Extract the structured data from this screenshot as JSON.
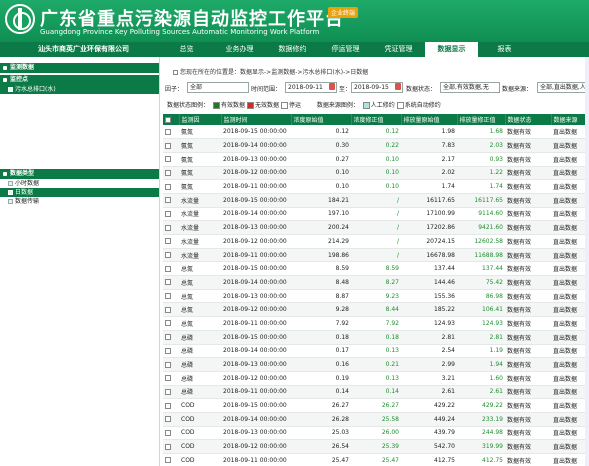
{
  "header": {
    "title": "广东省重点污染源自动监控工作平台",
    "subtitle": "Guangdong Province Key Polluting Sources Automatic Monitoring Work Platform",
    "badge": "企业终端"
  },
  "nav": {
    "company": "汕头市商英广业环保有限公司",
    "items": [
      "总览",
      "业务办理",
      "数据修约",
      "停运管理",
      "凭证管理",
      "数据显示",
      "报表"
    ],
    "active_index": 5
  },
  "sidebar": {
    "monitor_header": "监测数据",
    "point_header": "监控点",
    "point_item": "污水总排口(水)",
    "type_header": "数据类型",
    "types": [
      "小时数据",
      "日数据",
      "数据传输"
    ],
    "selected_type_index": 1
  },
  "breadcrumb": "您现在所在的位置是：数据显示->监测数据->污水总排口(水)->日数据",
  "filters": {
    "factor_label": "因子：",
    "factor_value": "全部",
    "time_label": "时间范围：",
    "start_date": "2018-09-11",
    "to_label": "至：",
    "end_date": "2018-09-15",
    "status_label": "数据状态：",
    "status_value": "全部,有效数据,无",
    "source_label": "数据来源：",
    "source_value": "全部,直出数据,人"
  },
  "legend": {
    "status_label": "数据状态图例：",
    "status_items": [
      {
        "label": "有效数据",
        "color": "#1f7a1f"
      },
      {
        "label": "无效数据",
        "color": "#d62a1e"
      },
      {
        "label": "停运",
        "color": "#ffffff"
      }
    ],
    "source_label": "数据来源图例：",
    "source_items": [
      {
        "label": "人工修约",
        "color": "#a8e6e0"
      },
      {
        "label": "系统自动修约",
        "color": "#ffffff"
      }
    ]
  },
  "table": {
    "columns": [
      "监测因",
      "监测时间",
      "浓度原始值",
      "浓度修正值",
      "排放量原始值",
      "排放量修正值",
      "数据状态",
      "数据来源"
    ],
    "rows": [
      [
        "氨氮",
        "2018-09-15 00:00:00",
        "0.12",
        "0.12",
        "1.98",
        "1.68",
        "数据有效",
        "直出数据"
      ],
      [
        "氨氮",
        "2018-09-14 00:00:00",
        "0.30",
        "0.22",
        "7.83",
        "2.03",
        "数据有效",
        "直出数据"
      ],
      [
        "氨氮",
        "2018-09-13 00:00:00",
        "0.27",
        "0.10",
        "2.17",
        "0.93",
        "数据有效",
        "直出数据"
      ],
      [
        "氨氮",
        "2018-09-12 00:00:00",
        "0.10",
        "0.10",
        "2.02",
        "1.22",
        "数据有效",
        "直出数据"
      ],
      [
        "氨氮",
        "2018-09-11 00:00:00",
        "0.10",
        "0.10",
        "1.74",
        "1.74",
        "数据有效",
        "直出数据"
      ],
      [
        "水流量",
        "2018-09-15 00:00:00",
        "184.21",
        "/",
        "16117.65",
        "16117.65",
        "数据有效",
        "直出数据"
      ],
      [
        "水流量",
        "2018-09-14 00:00:00",
        "197.10",
        "/",
        "17100.99",
        "9114.60",
        "数据有效",
        "直出数据"
      ],
      [
        "水流量",
        "2018-09-13 00:00:00",
        "200.24",
        "/",
        "17202.86",
        "9421.60",
        "数据有效",
        "直出数据"
      ],
      [
        "水流量",
        "2018-09-12 00:00:00",
        "214.29",
        "/",
        "20724.15",
        "12602.58",
        "数据有效",
        "直出数据"
      ],
      [
        "水流量",
        "2018-09-11 00:00:00",
        "198.86",
        "/",
        "16678.98",
        "11688.98",
        "数据有效",
        "直出数据"
      ],
      [
        "总氮",
        "2018-09-15 00:00:00",
        "8.59",
        "8.59",
        "137.44",
        "137.44",
        "数据有效",
        "直出数据"
      ],
      [
        "总氮",
        "2018-09-14 00:00:00",
        "8.48",
        "8.27",
        "144.46",
        "75.42",
        "数据有效",
        "直出数据"
      ],
      [
        "总氮",
        "2018-09-13 00:00:00",
        "8.87",
        "9.23",
        "155.36",
        "86.98",
        "数据有效",
        "直出数据"
      ],
      [
        "总氮",
        "2018-09-12 00:00:00",
        "9.28",
        "8.44",
        "185.22",
        "106.41",
        "数据有效",
        "直出数据"
      ],
      [
        "总氮",
        "2018-09-11 00:00:00",
        "7.92",
        "7.92",
        "124.93",
        "124.93",
        "数据有效",
        "直出数据"
      ],
      [
        "总磷",
        "2018-09-15 00:00:00",
        "0.18",
        "0.18",
        "2.81",
        "2.81",
        "数据有效",
        "直出数据"
      ],
      [
        "总磷",
        "2018-09-14 00:00:00",
        "0.17",
        "0.13",
        "2.54",
        "1.19",
        "数据有效",
        "直出数据"
      ],
      [
        "总磷",
        "2018-09-13 00:00:00",
        "0.16",
        "0.21",
        "2.99",
        "1.94",
        "数据有效",
        "直出数据"
      ],
      [
        "总磷",
        "2018-09-12 00:00:00",
        "0.19",
        "0.13",
        "3.21",
        "1.60",
        "数据有效",
        "直出数据"
      ],
      [
        "总磷",
        "2018-09-11 00:00:00",
        "0.14",
        "0.14",
        "2.61",
        "2.61",
        "数据有效",
        "直出数据"
      ],
      [
        "COD",
        "2018-09-15 00:00:00",
        "26.27",
        "26.27",
        "429.22",
        "429.22",
        "数据有效",
        "直出数据"
      ],
      [
        "COD",
        "2018-09-14 00:00:00",
        "26.28",
        "25.58",
        "449.24",
        "233.19",
        "数据有效",
        "直出数据"
      ],
      [
        "COD",
        "2018-09-13 00:00:00",
        "25.03",
        "26.00",
        "439.79",
        "244.98",
        "数据有效",
        "直出数据"
      ],
      [
        "COD",
        "2018-09-12 00:00:00",
        "26.54",
        "25.39",
        "542.70",
        "319.99",
        "数据有效",
        "直出数据"
      ],
      [
        "COD",
        "2018-09-11 00:00:00",
        "25.47",
        "25.47",
        "412.75",
        "412.75",
        "数据有效",
        "直出数据"
      ]
    ]
  }
}
